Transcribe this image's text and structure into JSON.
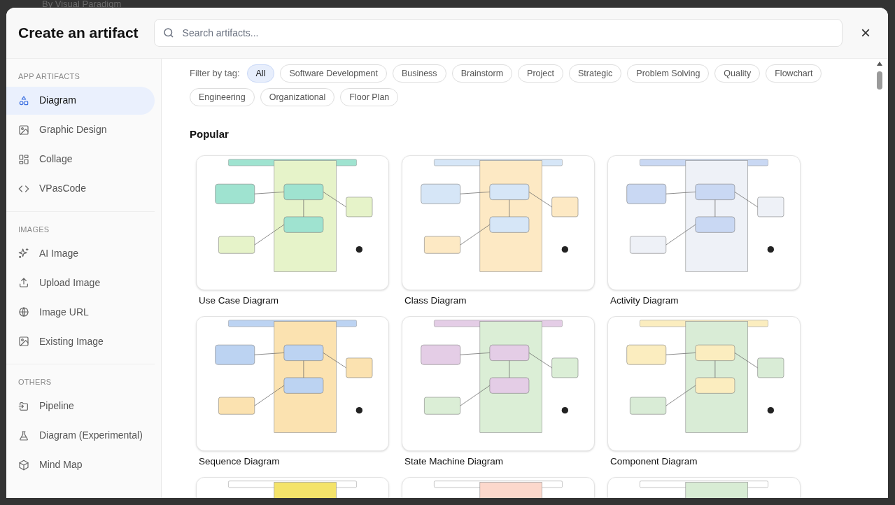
{
  "background": {
    "caption": "By Visual Paradigm"
  },
  "dialog": {
    "title": "Create an artifact",
    "search": {
      "placeholder": "Search artifacts..."
    },
    "close": "×"
  },
  "sidebar": [
    {
      "heading": "APP ARTIFACTS",
      "items": [
        {
          "label": "Diagram",
          "selected": true
        },
        {
          "label": "Graphic Design",
          "selected": false
        },
        {
          "label": "Collage",
          "selected": false
        },
        {
          "label": "VPasCode",
          "selected": false
        }
      ]
    },
    {
      "heading": "IMAGES",
      "items": [
        {
          "label": "AI Image",
          "selected": false
        },
        {
          "label": "Upload Image",
          "selected": false
        },
        {
          "label": "Image URL",
          "selected": false
        },
        {
          "label": "Existing Image",
          "selected": false
        }
      ]
    },
    {
      "heading": "OTHERS",
      "items": [
        {
          "label": "Pipeline",
          "selected": false
        },
        {
          "label": "Diagram (Experimental)",
          "selected": false
        },
        {
          "label": "Mind Map",
          "selected": false
        }
      ]
    }
  ],
  "filter": {
    "label": "Filter by tag:",
    "tags": [
      {
        "label": "All",
        "selected": true
      },
      {
        "label": "Software Development",
        "selected": false
      },
      {
        "label": "Business",
        "selected": false
      },
      {
        "label": "Brainstorm",
        "selected": false
      },
      {
        "label": "Project",
        "selected": false
      },
      {
        "label": "Strategic",
        "selected": false
      },
      {
        "label": "Problem Solving",
        "selected": false
      },
      {
        "label": "Quality",
        "selected": false
      },
      {
        "label": "Flowchart",
        "selected": false
      },
      {
        "label": "Engineering",
        "selected": false
      },
      {
        "label": "Organizational",
        "selected": false
      },
      {
        "label": "Floor Plan",
        "selected": false
      }
    ]
  },
  "section": {
    "title": "Popular",
    "cards": [
      {
        "title": "Use Case Diagram",
        "kind": "picture"
      },
      {
        "title": "Class Diagram",
        "kind": "picture"
      },
      {
        "title": "Activity Diagram",
        "kind": "picture"
      },
      {
        "title": "Sequence Diagram",
        "kind": "picture"
      },
      {
        "title": "State Machine Diagram",
        "kind": "picture"
      },
      {
        "title": "Component Diagram",
        "kind": "picture"
      },
      {
        "kind": "picture"
      },
      {
        "kind": "picture"
      },
      {
        "kind": "picture"
      }
    ]
  }
}
